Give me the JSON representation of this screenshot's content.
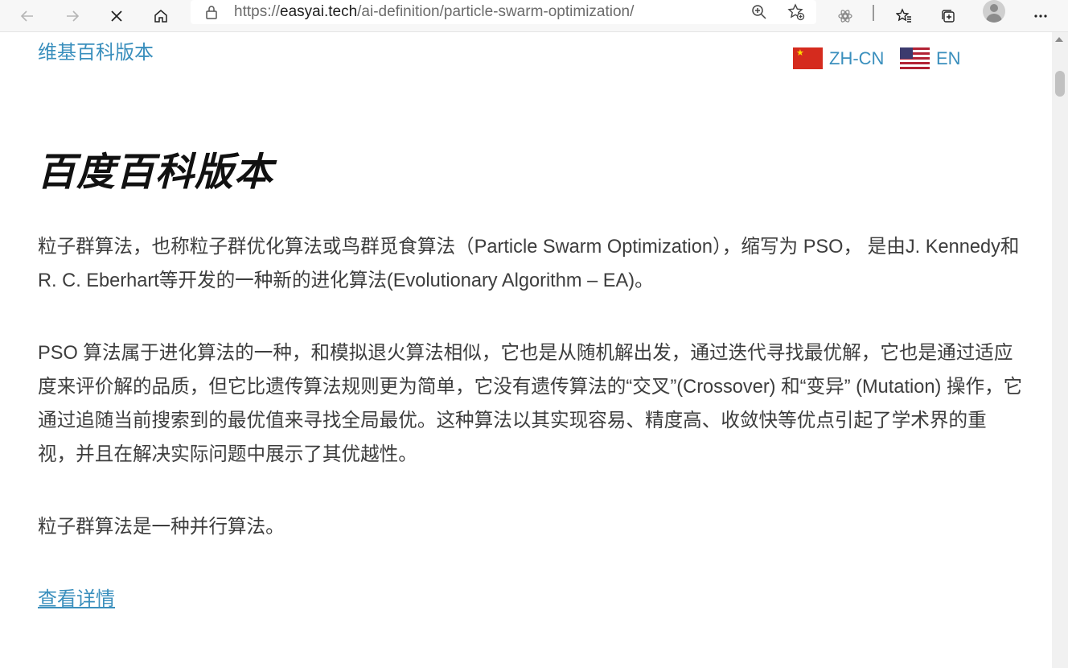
{
  "browser": {
    "url_prefix": "https://",
    "url_host": "easyai.tech",
    "url_path": "/ai-definition/particle-swarm-optimization/",
    "icons": [
      "back-icon",
      "forward-icon",
      "close-icon",
      "home-icon",
      "lock-icon",
      "zoom-icon",
      "add-favorite-icon",
      "extensions-icon",
      "favorites-icon",
      "collections-icon",
      "profile-icon",
      "more-icon"
    ]
  },
  "page": {
    "wiki_link": "维基百科版本",
    "languages": [
      {
        "code": "ZH-CN",
        "flag": "china-flag-icon"
      },
      {
        "code": "EN",
        "flag": "us-flag-icon"
      }
    ],
    "heading": "百度百科版本",
    "paragraphs": [
      "粒子群算法，也称粒子群优化算法或鸟群觅食算法（Particle Swarm Optimization），缩写为 PSO， 是由J. Kennedy和R. C. Eberhart等开发的一种新的进化算法(Evolutionary Algorithm – EA)。",
      "PSO 算法属于进化算法的一种，和模拟退火算法相似，它也是从随机解出发，通过迭代寻找最优解，它也是通过适应度来评价解的品质，但它比遗传算法规则更为简单，它没有遗传算法的“交叉”(Crossover) 和“变异” (Mutation) 操作，它通过追随当前搜索到的最优值来寻找全局最优。这种算法以其实现容易、精度高、收敛快等优点引起了学术界的重视，并且在解决实际问题中展示了其优越性。",
      "粒子群算法是一种并行算法。"
    ],
    "more_link": "查看详情"
  }
}
